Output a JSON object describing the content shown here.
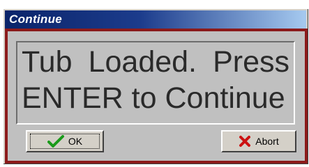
{
  "window": {
    "title": "Continue"
  },
  "message": {
    "line1": "Tub Loaded.  Press",
    "line2": "ENTER to Continue"
  },
  "buttons": {
    "ok": {
      "label": "OK",
      "icon": "checkmark-icon",
      "icon_color": "#1a9a1a"
    },
    "abort": {
      "label": "Abort",
      "icon": "x-icon",
      "icon_color": "#cc1111"
    }
  },
  "colors": {
    "title_bar_start": "#0a246a",
    "title_bar_end": "#a6caf0",
    "frame_border": "#8b1a1a",
    "panel_bg": "#c0c0c0"
  }
}
